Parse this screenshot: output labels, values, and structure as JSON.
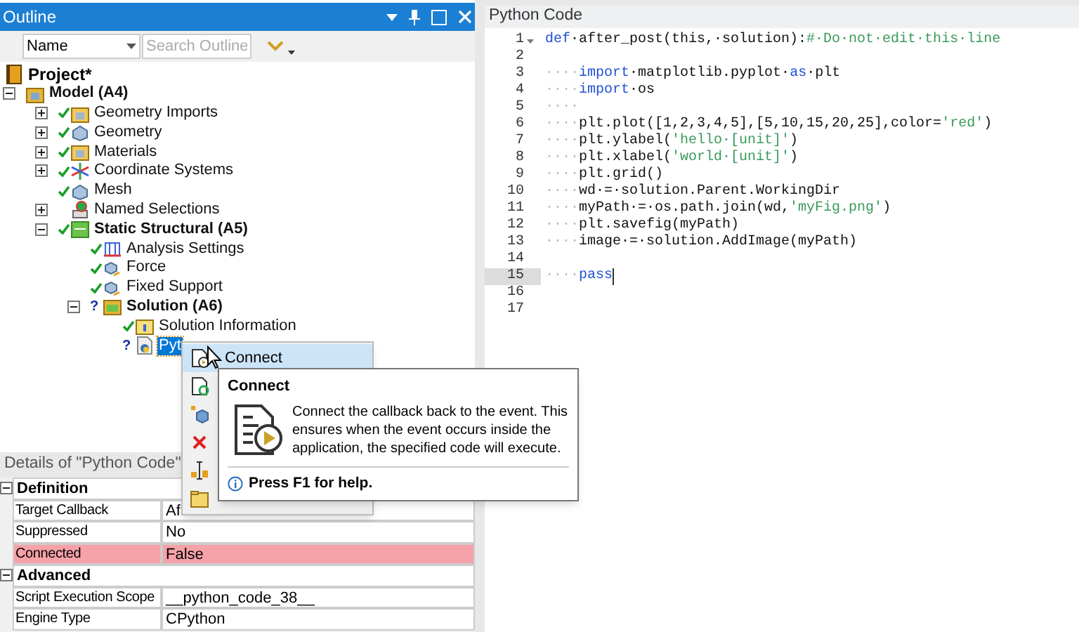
{
  "outline": {
    "title": "Outline",
    "filter": {
      "value": "Name"
    },
    "search": {
      "placeholder": "Search Outline"
    },
    "root": {
      "label": "Project*"
    },
    "tree": [
      {
        "label": "Model (A4)",
        "kind": "model",
        "bold": true,
        "expanded": true,
        "children": [
          {
            "label": "Geometry Imports",
            "kind": "folder",
            "checked": true,
            "bold": false,
            "expanded": false
          },
          {
            "label": "Geometry",
            "kind": "geometry",
            "checked": true,
            "bold": false,
            "expanded": false
          },
          {
            "label": "Materials",
            "kind": "folder",
            "checked": true,
            "bold": false,
            "expanded": false
          },
          {
            "label": "Coordinate Systems",
            "kind": "axes",
            "checked": true,
            "bold": false,
            "expanded": false
          },
          {
            "label": "Mesh",
            "kind": "geometry",
            "checked": true,
            "bold": false
          },
          {
            "label": "Named Selections",
            "kind": "selection",
            "checked": false,
            "bold": false,
            "expanded": false
          },
          {
            "label": "Static Structural (A5)",
            "kind": "analysis",
            "bold": true,
            "checked": true,
            "expanded": true,
            "children": [
              {
                "label": "Analysis Settings",
                "kind": "settings",
                "checked": true,
                "bold": false
              },
              {
                "label": "Force",
                "kind": "load",
                "checked": true,
                "bold": false
              },
              {
                "label": "Fixed Support",
                "kind": "load",
                "checked": true,
                "bold": false
              },
              {
                "label": "Solution (A6)",
                "kind": "solution",
                "bold": true,
                "mark": "?",
                "expanded": true,
                "children": [
                  {
                    "label": "Solution Information",
                    "kind": "info",
                    "checked": true,
                    "bold": false,
                    "selected": false
                  },
                  {
                    "label": "Pyt",
                    "kind": "script",
                    "mark": "?",
                    "bold": false,
                    "selected": true
                  }
                ]
              }
            ]
          }
        ]
      }
    ]
  },
  "details": {
    "title": "Details of \"Python Code\"",
    "sections": [
      {
        "title": "Definition",
        "expanded": true,
        "rows": [
          {
            "name": "Target Callback",
            "value": "Af",
            "error": false
          },
          {
            "name": "Suppressed",
            "value": "No",
            "error": false
          },
          {
            "name": "Connected",
            "value": "False",
            "error": true
          }
        ]
      },
      {
        "title": "Advanced",
        "expanded": true,
        "rows": [
          {
            "name": "Script Execution Scope",
            "value": "__python_code_38__",
            "error": false
          },
          {
            "name": "Engine Type",
            "value": "CPython",
            "error": false
          }
        ]
      }
    ]
  },
  "menu": [
    {
      "kind": "connect",
      "label": "Connect",
      "selected": true
    },
    {
      "kind": "reload",
      "selected": false
    },
    {
      "kind": "duplicate",
      "selected": false
    },
    {
      "kind": "delete",
      "selected": false
    },
    {
      "kind": "rename",
      "selected": false
    },
    {
      "kind": "open",
      "selected": false
    }
  ],
  "tooltip": {
    "title": "Connect",
    "body": "Connect the callback back to the event. This ensures when the event occurs inside the application, the specified code will execute.",
    "help": "Press F1 for help."
  },
  "editor": {
    "title": "Python Code",
    "lines": [
      {
        "n": "1",
        "fold": true,
        "current": false,
        "tokens": [
          {
            "t": "def",
            "kind": "keyword"
          },
          {
            "t": "·after_post(this,·solution):",
            "kind": "plain"
          },
          {
            "t": "#·Do·not·edit·this·line",
            "kind": "comment"
          }
        ]
      },
      {
        "n": "2",
        "current": false
      },
      {
        "n": "3",
        "current": false,
        "tokens": [
          {
            "t": "····",
            "kind": "space"
          },
          {
            "t": "import",
            "kind": "keyword"
          },
          {
            "t": "·matplotlib.pyplot·",
            "kind": "plain"
          },
          {
            "t": "as",
            "kind": "keyword"
          },
          {
            "t": "·plt",
            "kind": "plain"
          }
        ]
      },
      {
        "n": "4",
        "current": false,
        "tokens": [
          {
            "t": "····",
            "kind": "space"
          },
          {
            "t": "import",
            "kind": "keyword"
          },
          {
            "t": "·os",
            "kind": "plain"
          }
        ]
      },
      {
        "n": "5",
        "current": false,
        "tokens": [
          {
            "t": "····",
            "kind": "space"
          }
        ]
      },
      {
        "n": "6",
        "current": false,
        "tokens": [
          {
            "t": "····",
            "kind": "space"
          },
          {
            "t": "plt.plot([1,2,3,4,5],[5,10,15,20,25],color=",
            "kind": "plain"
          },
          {
            "t": "'red'",
            "kind": "string"
          },
          {
            "t": ")",
            "kind": "plain"
          }
        ]
      },
      {
        "n": "7",
        "current": false,
        "tokens": [
          {
            "t": "····",
            "kind": "space"
          },
          {
            "t": "plt.ylabel(",
            "kind": "plain"
          },
          {
            "t": "'hello·[unit]'",
            "kind": "string"
          },
          {
            "t": ")",
            "kind": "plain"
          }
        ]
      },
      {
        "n": "8",
        "current": false,
        "tokens": [
          {
            "t": "····",
            "kind": "space"
          },
          {
            "t": "plt.xlabel(",
            "kind": "plain"
          },
          {
            "t": "'world·[unit]'",
            "kind": "string"
          },
          {
            "t": ")",
            "kind": "plain"
          }
        ]
      },
      {
        "n": "9",
        "current": false,
        "tokens": [
          {
            "t": "····",
            "kind": "space"
          },
          {
            "t": "plt.grid()",
            "kind": "plain"
          }
        ]
      },
      {
        "n": "10",
        "current": false,
        "tokens": [
          {
            "t": "····",
            "kind": "space"
          },
          {
            "t": "wd·=·solution.Parent.WorkingDir",
            "kind": "plain"
          }
        ]
      },
      {
        "n": "11",
        "current": false,
        "tokens": [
          {
            "t": "····",
            "kind": "space"
          },
          {
            "t": "myPath·=·os.path.join(wd,",
            "kind": "plain"
          },
          {
            "t": "'myFig.png'",
            "kind": "string"
          },
          {
            "t": ")",
            "kind": "plain"
          }
        ]
      },
      {
        "n": "12",
        "current": false,
        "tokens": [
          {
            "t": "····",
            "kind": "space"
          },
          {
            "t": "plt.savefig(myPath)",
            "kind": "plain"
          }
        ]
      },
      {
        "n": "13",
        "current": false,
        "tokens": [
          {
            "t": "····",
            "kind": "space"
          },
          {
            "t": "image·=·solution.AddImage(myPath)",
            "kind": "plain"
          }
        ]
      },
      {
        "n": "14",
        "current": false
      },
      {
        "n": "15",
        "current": true,
        "tokens": [
          {
            "t": "····",
            "kind": "space"
          },
          {
            "t": "pass",
            "kind": "keyword"
          }
        ]
      },
      {
        "n": "16",
        "current": false
      },
      {
        "n": "17",
        "current": false
      }
    ]
  }
}
